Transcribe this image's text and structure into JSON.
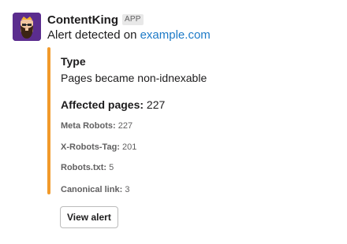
{
  "message": {
    "sender": "ContentKing",
    "app_badge": "APP",
    "alert_prefix": "Alert detected on ",
    "alert_link": "example.com"
  },
  "attachment": {
    "accent_color": "#f29a2b",
    "type_title": "Type",
    "type_value": "Pages became non-idnexable",
    "affected_label": "Affected pages:",
    "affected_count": "227",
    "stats": [
      {
        "label": "Meta Robots:",
        "value": "227"
      },
      {
        "label": "X-Robots-Tag:",
        "value": "201"
      },
      {
        "label": "Robots.txt:",
        "value": "5"
      },
      {
        "label": "Canonical link:",
        "value": "3"
      }
    ]
  },
  "actions": {
    "view_alert_label": "View alert"
  }
}
